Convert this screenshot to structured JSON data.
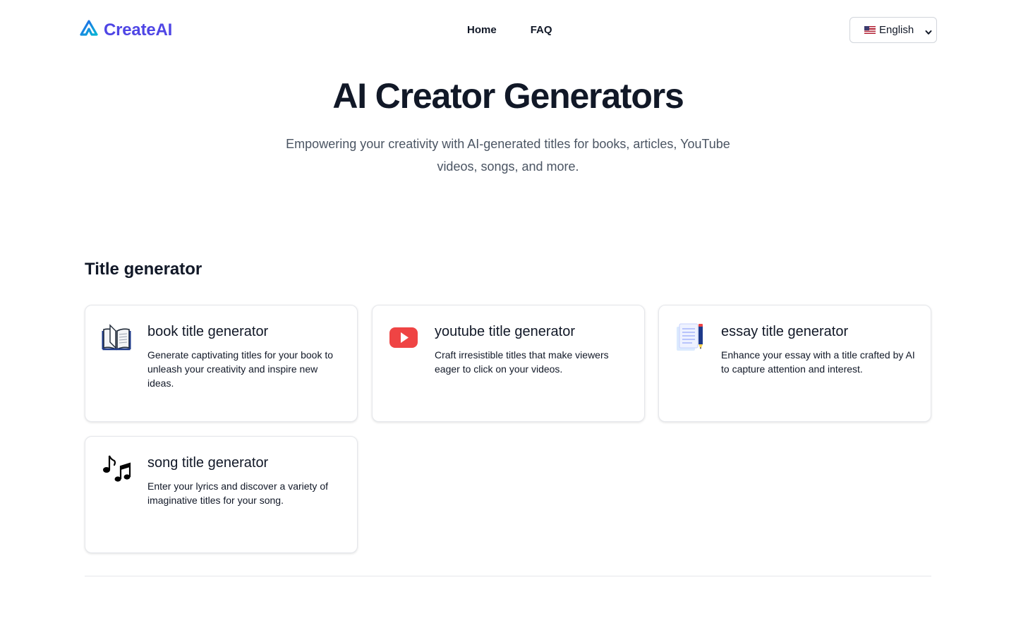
{
  "header": {
    "logo_text": "CreateAI",
    "nav": [
      {
        "label": "Home"
      },
      {
        "label": "FAQ"
      }
    ],
    "language": {
      "selected": "English",
      "icon": "us-flag-icon"
    }
  },
  "hero": {
    "title": "AI Creator Generators",
    "subtitle": "Empowering your creativity with AI-generated titles for books, articles, YouTube videos, songs, and more."
  },
  "section": {
    "title": "Title generator",
    "cards": [
      {
        "title": "book title generator",
        "description": "Generate captivating titles for your book to unleash your creativity and inspire new ideas.",
        "icon": "open-book-icon"
      },
      {
        "title": "youtube title generator",
        "description": "Craft irresistible titles that make viewers eager to click on your videos.",
        "icon": "youtube-play-icon"
      },
      {
        "title": "essay title generator",
        "description": "Enhance your essay with a title crafted by AI to capture attention and interest.",
        "icon": "document-pencil-icon"
      },
      {
        "title": "song title generator",
        "description": "Enter your lyrics and discover a variety of imaginative titles for your song.",
        "icon": "music-notes-icon"
      }
    ]
  },
  "colors": {
    "brand": "#4f46e5",
    "logo_gradient_start": "#3b82f6",
    "logo_gradient_end": "#06b6d4",
    "text_primary": "#111827",
    "text_muted": "#4b5563",
    "youtube_red": "#ef4444",
    "border": "#e5e7eb"
  }
}
